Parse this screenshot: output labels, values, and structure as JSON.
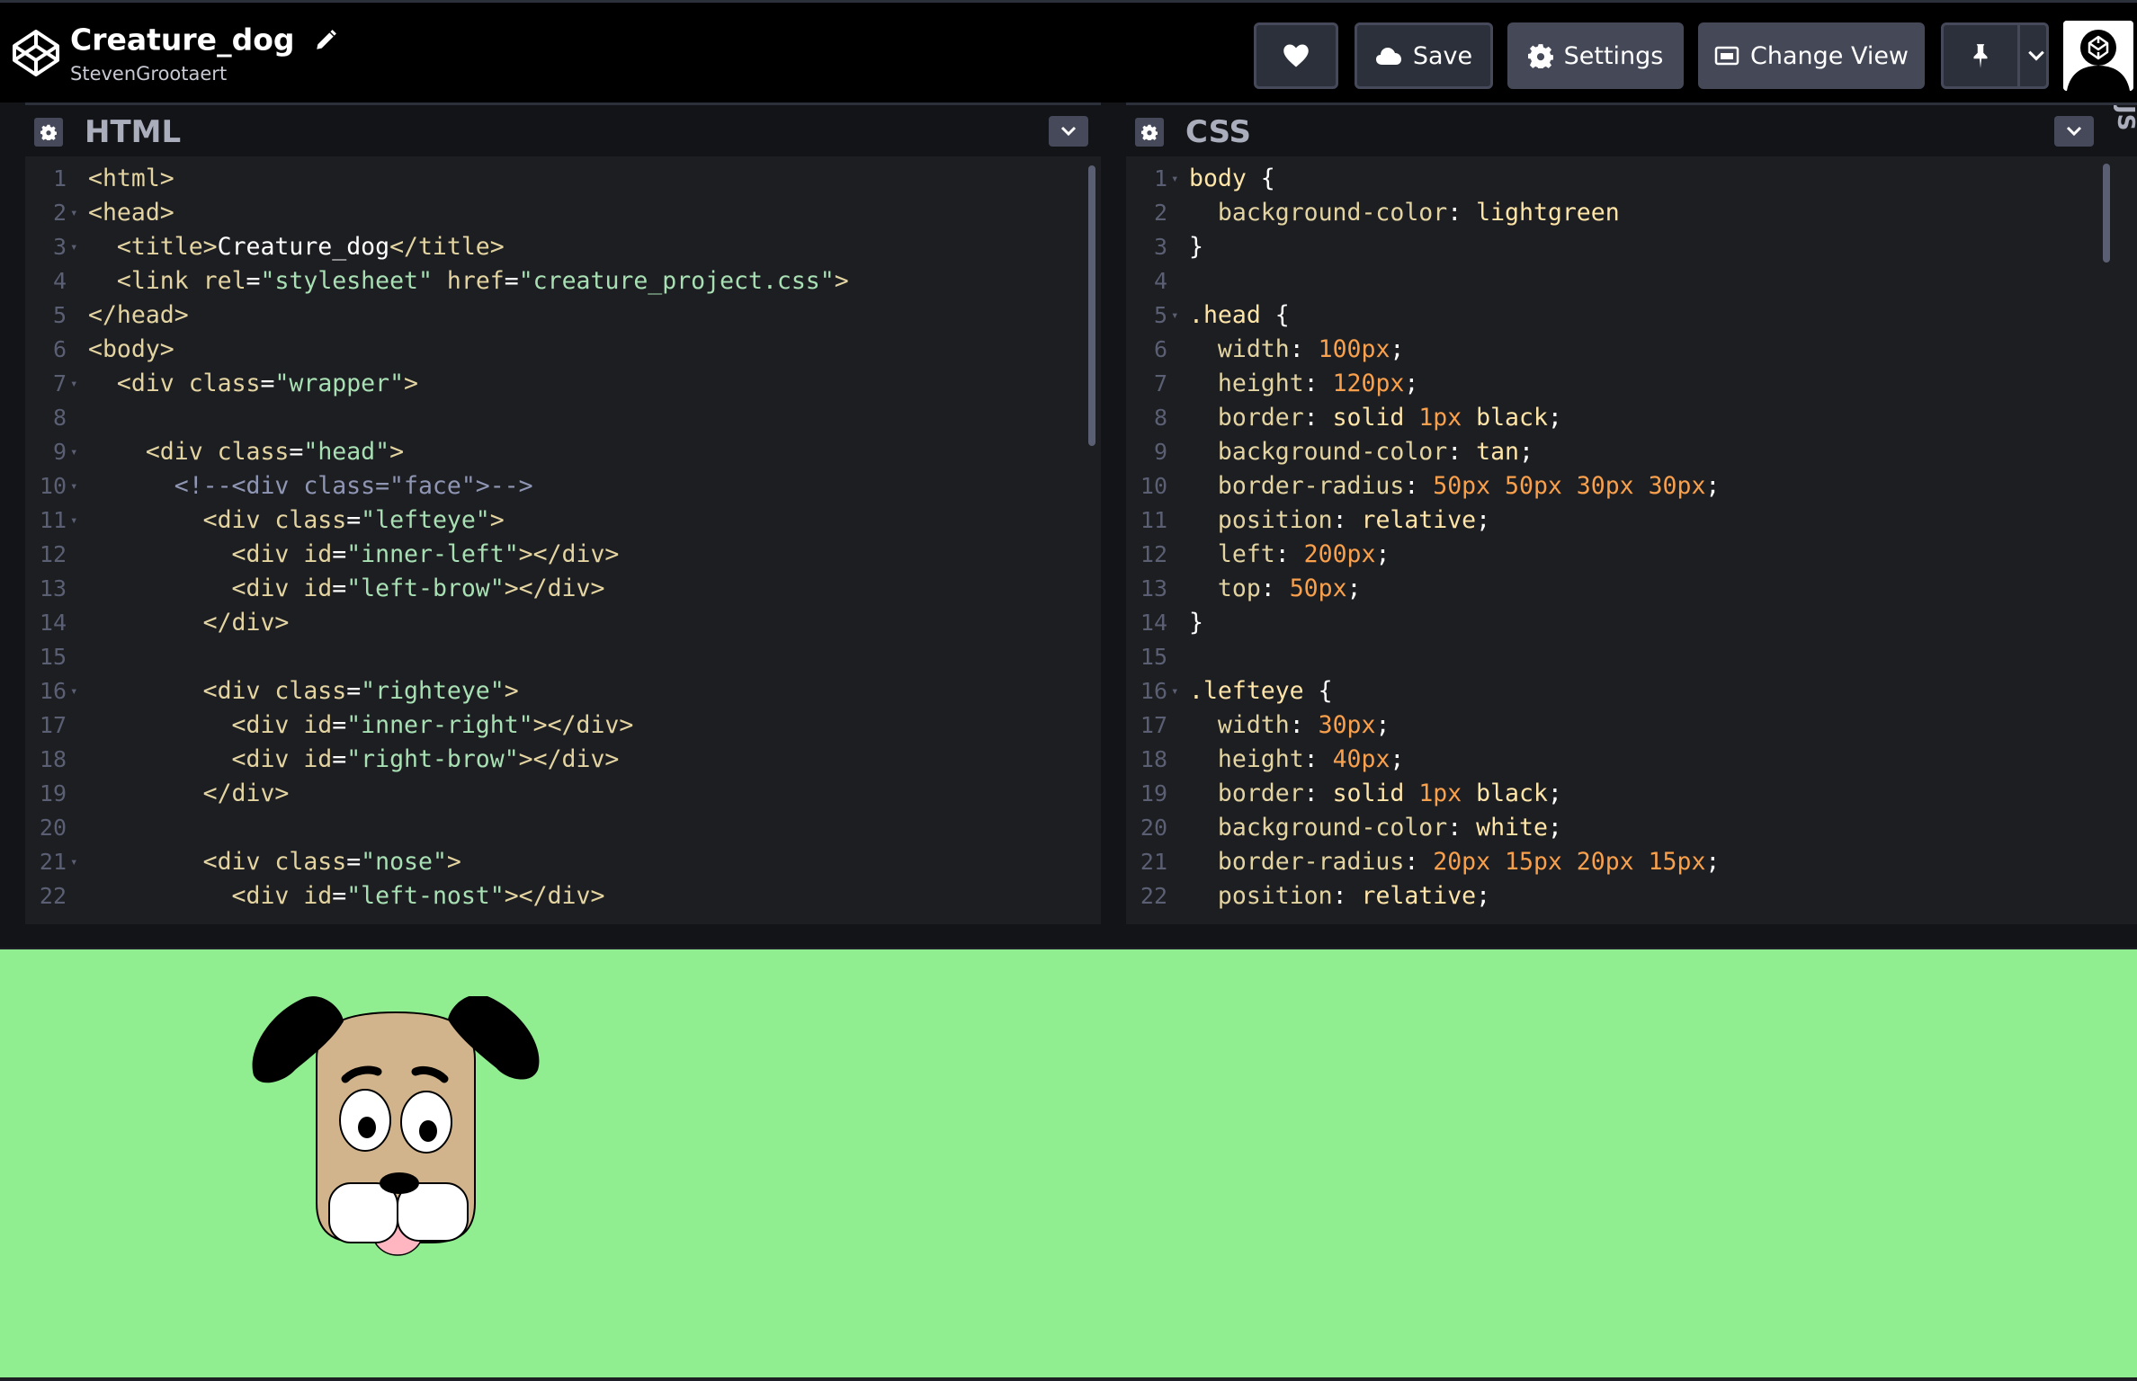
{
  "header": {
    "pen_title": "Creature_dog",
    "author": "StevenGrootaert",
    "buttons": {
      "save": "Save",
      "settings": "Settings",
      "change_view": "Change View"
    }
  },
  "panels": {
    "html": {
      "title": "HTML"
    },
    "css": {
      "title": "CSS"
    },
    "js_tab": "JS"
  },
  "html_code": [
    {
      "n": "1",
      "fold": false,
      "tokens": [
        {
          "t": "tag",
          "v": "<html>"
        }
      ]
    },
    {
      "n": "2",
      "fold": true,
      "tokens": [
        {
          "t": "tag",
          "v": "<head>"
        }
      ]
    },
    {
      "n": "3",
      "fold": true,
      "tokens": [
        {
          "t": "txt",
          "v": "  "
        },
        {
          "t": "tag",
          "v": "<title>"
        },
        {
          "t": "txt",
          "v": "Creature_dog"
        },
        {
          "t": "tag",
          "v": "</title>"
        }
      ]
    },
    {
      "n": "4",
      "fold": false,
      "tokens": [
        {
          "t": "txt",
          "v": "  "
        },
        {
          "t": "tag",
          "v": "<link "
        },
        {
          "t": "attr",
          "v": "rel"
        },
        {
          "t": "punc",
          "v": "="
        },
        {
          "t": "str",
          "v": "\"stylesheet\""
        },
        {
          "t": "txt",
          "v": " "
        },
        {
          "t": "attr",
          "v": "href"
        },
        {
          "t": "punc",
          "v": "="
        },
        {
          "t": "str",
          "v": "\"creature_project.css\""
        },
        {
          "t": "tag",
          "v": ">"
        }
      ]
    },
    {
      "n": "5",
      "fold": false,
      "tokens": [
        {
          "t": "tag",
          "v": "</head>"
        }
      ]
    },
    {
      "n": "6",
      "fold": false,
      "tokens": [
        {
          "t": "tag",
          "v": "<body>"
        }
      ]
    },
    {
      "n": "7",
      "fold": true,
      "tokens": [
        {
          "t": "txt",
          "v": "  "
        },
        {
          "t": "tag",
          "v": "<div "
        },
        {
          "t": "attr",
          "v": "class"
        },
        {
          "t": "punc",
          "v": "="
        },
        {
          "t": "str",
          "v": "\"wrapper\""
        },
        {
          "t": "tag",
          "v": ">"
        }
      ]
    },
    {
      "n": "8",
      "fold": false,
      "tokens": []
    },
    {
      "n": "9",
      "fold": true,
      "tokens": [
        {
          "t": "txt",
          "v": "    "
        },
        {
          "t": "tag",
          "v": "<div "
        },
        {
          "t": "attr",
          "v": "class"
        },
        {
          "t": "punc",
          "v": "="
        },
        {
          "t": "str",
          "v": "\"head\""
        },
        {
          "t": "tag",
          "v": ">"
        }
      ]
    },
    {
      "n": "10",
      "fold": true,
      "tokens": [
        {
          "t": "txt",
          "v": "      "
        },
        {
          "t": "cmt",
          "v": "<!--<div class=\"face\">-->"
        }
      ]
    },
    {
      "n": "11",
      "fold": true,
      "tokens": [
        {
          "t": "txt",
          "v": "        "
        },
        {
          "t": "tag",
          "v": "<div "
        },
        {
          "t": "attr",
          "v": "class"
        },
        {
          "t": "punc",
          "v": "="
        },
        {
          "t": "str",
          "v": "\"lefteye\""
        },
        {
          "t": "tag",
          "v": ">"
        }
      ]
    },
    {
      "n": "12",
      "fold": false,
      "tokens": [
        {
          "t": "txt",
          "v": "          "
        },
        {
          "t": "tag",
          "v": "<div "
        },
        {
          "t": "attr",
          "v": "id"
        },
        {
          "t": "punc",
          "v": "="
        },
        {
          "t": "str",
          "v": "\"inner-left\""
        },
        {
          "t": "tag",
          "v": "></div>"
        }
      ]
    },
    {
      "n": "13",
      "fold": false,
      "tokens": [
        {
          "t": "txt",
          "v": "          "
        },
        {
          "t": "tag",
          "v": "<div "
        },
        {
          "t": "attr",
          "v": "id"
        },
        {
          "t": "punc",
          "v": "="
        },
        {
          "t": "str",
          "v": "\"left-brow\""
        },
        {
          "t": "tag",
          "v": "></div>"
        }
      ]
    },
    {
      "n": "14",
      "fold": false,
      "tokens": [
        {
          "t": "txt",
          "v": "        "
        },
        {
          "t": "tag",
          "v": "</div>"
        }
      ]
    },
    {
      "n": "15",
      "fold": false,
      "tokens": []
    },
    {
      "n": "16",
      "fold": true,
      "tokens": [
        {
          "t": "txt",
          "v": "        "
        },
        {
          "t": "tag",
          "v": "<div "
        },
        {
          "t": "attr",
          "v": "class"
        },
        {
          "t": "punc",
          "v": "="
        },
        {
          "t": "str",
          "v": "\"righteye\""
        },
        {
          "t": "tag",
          "v": ">"
        }
      ]
    },
    {
      "n": "17",
      "fold": false,
      "tokens": [
        {
          "t": "txt",
          "v": "          "
        },
        {
          "t": "tag",
          "v": "<div "
        },
        {
          "t": "attr",
          "v": "id"
        },
        {
          "t": "punc",
          "v": "="
        },
        {
          "t": "str",
          "v": "\"inner-right\""
        },
        {
          "t": "tag",
          "v": "></div>"
        }
      ]
    },
    {
      "n": "18",
      "fold": false,
      "tokens": [
        {
          "t": "txt",
          "v": "          "
        },
        {
          "t": "tag",
          "v": "<div "
        },
        {
          "t": "attr",
          "v": "id"
        },
        {
          "t": "punc",
          "v": "="
        },
        {
          "t": "str",
          "v": "\"right-brow\""
        },
        {
          "t": "tag",
          "v": "></div>"
        }
      ]
    },
    {
      "n": "19",
      "fold": false,
      "tokens": [
        {
          "t": "txt",
          "v": "        "
        },
        {
          "t": "tag",
          "v": "</div>"
        }
      ]
    },
    {
      "n": "20",
      "fold": false,
      "tokens": []
    },
    {
      "n": "21",
      "fold": true,
      "tokens": [
        {
          "t": "txt",
          "v": "        "
        },
        {
          "t": "tag",
          "v": "<div "
        },
        {
          "t": "attr",
          "v": "class"
        },
        {
          "t": "punc",
          "v": "="
        },
        {
          "t": "str",
          "v": "\"nose\""
        },
        {
          "t": "tag",
          "v": ">"
        }
      ]
    },
    {
      "n": "22",
      "fold": false,
      "tokens": [
        {
          "t": "txt",
          "v": "          "
        },
        {
          "t": "tag",
          "v": "<div "
        },
        {
          "t": "attr",
          "v": "id"
        },
        {
          "t": "punc",
          "v": "="
        },
        {
          "t": "str",
          "v": "\"left-nost\""
        },
        {
          "t": "tag",
          "v": "></div>"
        }
      ]
    }
  ],
  "css_code": [
    {
      "n": "1",
      "fold": true,
      "tokens": [
        {
          "t": "sel",
          "v": "body"
        },
        {
          "t": "punc",
          "v": " {"
        }
      ]
    },
    {
      "n": "2",
      "fold": false,
      "tokens": [
        {
          "t": "txt",
          "v": "  "
        },
        {
          "t": "prop",
          "v": "background-color"
        },
        {
          "t": "punc",
          "v": ": "
        },
        {
          "t": "val",
          "v": "lightgreen"
        }
      ]
    },
    {
      "n": "3",
      "fold": false,
      "tokens": [
        {
          "t": "punc",
          "v": "}"
        }
      ]
    },
    {
      "n": "4",
      "fold": false,
      "tokens": []
    },
    {
      "n": "5",
      "fold": true,
      "tokens": [
        {
          "t": "sel",
          "v": ".head"
        },
        {
          "t": "punc",
          "v": " {"
        }
      ]
    },
    {
      "n": "6",
      "fold": false,
      "tokens": [
        {
          "t": "txt",
          "v": "  "
        },
        {
          "t": "prop",
          "v": "width"
        },
        {
          "t": "punc",
          "v": ": "
        },
        {
          "t": "num",
          "v": "100px"
        },
        {
          "t": "punc",
          "v": ";"
        }
      ]
    },
    {
      "n": "7",
      "fold": false,
      "tokens": [
        {
          "t": "txt",
          "v": "  "
        },
        {
          "t": "prop",
          "v": "height"
        },
        {
          "t": "punc",
          "v": ": "
        },
        {
          "t": "num",
          "v": "120px"
        },
        {
          "t": "punc",
          "v": ";"
        }
      ]
    },
    {
      "n": "8",
      "fold": false,
      "tokens": [
        {
          "t": "txt",
          "v": "  "
        },
        {
          "t": "prop",
          "v": "border"
        },
        {
          "t": "punc",
          "v": ": "
        },
        {
          "t": "val",
          "v": "solid "
        },
        {
          "t": "num",
          "v": "1px"
        },
        {
          "t": "val",
          "v": " black"
        },
        {
          "t": "punc",
          "v": ";"
        }
      ]
    },
    {
      "n": "9",
      "fold": false,
      "tokens": [
        {
          "t": "txt",
          "v": "  "
        },
        {
          "t": "prop",
          "v": "background-color"
        },
        {
          "t": "punc",
          "v": ": "
        },
        {
          "t": "val",
          "v": "tan"
        },
        {
          "t": "punc",
          "v": ";"
        }
      ]
    },
    {
      "n": "10",
      "fold": false,
      "tokens": [
        {
          "t": "txt",
          "v": "  "
        },
        {
          "t": "prop",
          "v": "border-radius"
        },
        {
          "t": "punc",
          "v": ": "
        },
        {
          "t": "num",
          "v": "50px 50px 30px 30px"
        },
        {
          "t": "punc",
          "v": ";"
        }
      ]
    },
    {
      "n": "11",
      "fold": false,
      "tokens": [
        {
          "t": "txt",
          "v": "  "
        },
        {
          "t": "prop",
          "v": "position"
        },
        {
          "t": "punc",
          "v": ": "
        },
        {
          "t": "val",
          "v": "relative"
        },
        {
          "t": "punc",
          "v": ";"
        }
      ]
    },
    {
      "n": "12",
      "fold": false,
      "tokens": [
        {
          "t": "txt",
          "v": "  "
        },
        {
          "t": "prop",
          "v": "left"
        },
        {
          "t": "punc",
          "v": ": "
        },
        {
          "t": "num",
          "v": "200px"
        },
        {
          "t": "punc",
          "v": ";"
        }
      ]
    },
    {
      "n": "13",
      "fold": false,
      "tokens": [
        {
          "t": "txt",
          "v": "  "
        },
        {
          "t": "prop",
          "v": "top"
        },
        {
          "t": "punc",
          "v": ": "
        },
        {
          "t": "num",
          "v": "50px"
        },
        {
          "t": "punc",
          "v": ";"
        }
      ]
    },
    {
      "n": "14",
      "fold": false,
      "tokens": [
        {
          "t": "punc",
          "v": "}"
        }
      ]
    },
    {
      "n": "15",
      "fold": false,
      "tokens": []
    },
    {
      "n": "16",
      "fold": true,
      "tokens": [
        {
          "t": "sel",
          "v": ".lefteye"
        },
        {
          "t": "punc",
          "v": " {"
        }
      ]
    },
    {
      "n": "17",
      "fold": false,
      "tokens": [
        {
          "t": "txt",
          "v": "  "
        },
        {
          "t": "prop",
          "v": "width"
        },
        {
          "t": "punc",
          "v": ": "
        },
        {
          "t": "num",
          "v": "30px"
        },
        {
          "t": "punc",
          "v": ";"
        }
      ]
    },
    {
      "n": "18",
      "fold": false,
      "tokens": [
        {
          "t": "txt",
          "v": "  "
        },
        {
          "t": "prop",
          "v": "height"
        },
        {
          "t": "punc",
          "v": ": "
        },
        {
          "t": "num",
          "v": "40px"
        },
        {
          "t": "punc",
          "v": ";"
        }
      ]
    },
    {
      "n": "19",
      "fold": false,
      "tokens": [
        {
          "t": "txt",
          "v": "  "
        },
        {
          "t": "prop",
          "v": "border"
        },
        {
          "t": "punc",
          "v": ": "
        },
        {
          "t": "val",
          "v": "solid "
        },
        {
          "t": "num",
          "v": "1px"
        },
        {
          "t": "val",
          "v": " black"
        },
        {
          "t": "punc",
          "v": ";"
        }
      ]
    },
    {
      "n": "20",
      "fold": false,
      "tokens": [
        {
          "t": "txt",
          "v": "  "
        },
        {
          "t": "prop",
          "v": "background-color"
        },
        {
          "t": "punc",
          "v": ": "
        },
        {
          "t": "val",
          "v": "white"
        },
        {
          "t": "punc",
          "v": ";"
        }
      ]
    },
    {
      "n": "21",
      "fold": false,
      "tokens": [
        {
          "t": "txt",
          "v": "  "
        },
        {
          "t": "prop",
          "v": "border-radius"
        },
        {
          "t": "punc",
          "v": ": "
        },
        {
          "t": "num",
          "v": "20px 15px 20px 15px"
        },
        {
          "t": "punc",
          "v": ";"
        }
      ]
    },
    {
      "n": "22",
      "fold": false,
      "tokens": [
        {
          "t": "txt",
          "v": "  "
        },
        {
          "t": "prop",
          "v": "position"
        },
        {
          "t": "punc",
          "v": ": "
        },
        {
          "t": "val",
          "v": "relative"
        },
        {
          "t": "punc",
          "v": ";"
        }
      ]
    }
  ],
  "colors": {
    "preview_background": "#90ee90",
    "dog_head": "#d2b48c",
    "dog_ears": "#000000",
    "tongue": "#ffb6c1"
  },
  "icons": {
    "logo": "codepen-logo-icon",
    "edit": "pencil-icon",
    "heart": "heart-icon",
    "save": "cloud-icon",
    "settings": "gear-icon",
    "change_view": "layout-icon",
    "pin": "pin-icon",
    "dropdown": "chevron-down-icon"
  }
}
